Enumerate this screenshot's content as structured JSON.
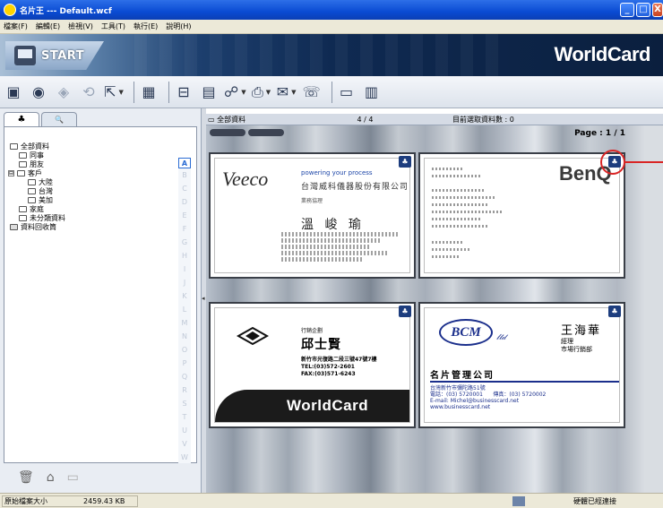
{
  "window": {
    "title": "名片王 --- Default.wcf",
    "min": "_",
    "max": "□",
    "close": "X"
  },
  "menu": [
    "檔案(F)",
    "編輯(E)",
    "檢視(V)",
    "工具(T)",
    "執行(E)",
    "說明(H)"
  ],
  "banner": {
    "start_label": "START",
    "brand": "WorldCard"
  },
  "left_tabs": [
    {
      "icon": "person-card-icon",
      "glyph": "♣"
    },
    {
      "icon": "search-icon",
      "glyph": "🔍"
    }
  ],
  "tree": {
    "root": "全部資料",
    "items": [
      {
        "label": "同事",
        "level": 1
      },
      {
        "label": "朋友",
        "level": 1
      },
      {
        "label": "客戶",
        "level": 1,
        "expander": "⊟"
      },
      {
        "label": "大陸",
        "level": 2
      },
      {
        "label": "台灣",
        "level": 2
      },
      {
        "label": "美加",
        "level": 2
      },
      {
        "label": "家庭",
        "level": 1
      },
      {
        "label": "未分類資料",
        "level": 1
      },
      {
        "label": "資料回收筒",
        "level": 0
      }
    ]
  },
  "alpha_index": [
    "A",
    "B",
    "C",
    "D",
    "E",
    "F",
    "G",
    "H",
    "I",
    "J",
    "K",
    "L",
    "M",
    "N",
    "O",
    "P",
    "Q",
    "R",
    "S",
    "T",
    "U",
    "V",
    "W"
  ],
  "alpha_selected": "A",
  "cards_header": {
    "path": "全部資料",
    "count": "4 / 4",
    "selected": "目前選取資料數 : 0",
    "page": "Page : 1 / 1"
  },
  "cards": [
    {
      "id": "veeco",
      "logo": "Veeco",
      "tagline": "powering your process",
      "company": "台灣威科儀器股份有限公司",
      "dept": "業務協理",
      "name": "溫 峻 瑜"
    },
    {
      "id": "benq",
      "brand": "BenQ"
    },
    {
      "id": "worldcard",
      "dept": "行銷企劃",
      "name": "邱士賢",
      "address": "新竹市光復路二段三號47號7樓\nTEL:(03)572-2601\nFAX:(03)571-6243",
      "band": "WorldCard"
    },
    {
      "id": "bcm",
      "logo": "BCM",
      "logo_sub": "𝓁𝓉𝒹",
      "name": "王海華",
      "title": "經理\n市場行銷部",
      "company": "名片管理公司",
      "address": "台灣新竹市彌陀路51號\n電話：(03) 5720001      傳真：(03) 5720002\nE-mail: Michel@businesscard.net\nwww.businesscard.net"
    }
  ],
  "status": {
    "label": "原始檔案大小",
    "size": "2459.43 KB",
    "connection": "硬體已經連接"
  }
}
